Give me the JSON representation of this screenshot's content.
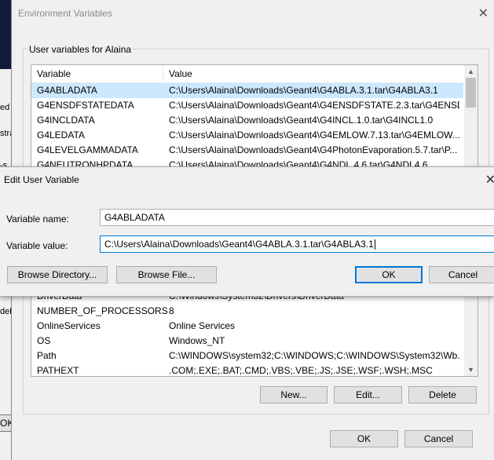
{
  "background_fragments": [
    "ed",
    "stra",
    "-s",
    "deb",
    "OK"
  ],
  "env_window": {
    "title": "Environment Variables",
    "user_group_label": "User variables for Alaina",
    "columns": [
      "Variable",
      "Value"
    ],
    "rows_top": [
      {
        "variable": "G4ABLADATA",
        "value": "C:\\Users\\Alaina\\Downloads\\Geant4\\G4ABLA.3.1.tar\\G4ABLA3.1"
      },
      {
        "variable": "G4ENSDFSTATEDATA",
        "value": "C:\\Users\\Alaina\\Downloads\\Geant4\\G4ENSDFSTATE.2.3.tar\\G4ENSD..."
      },
      {
        "variable": "G4INCLDATA",
        "value": "C:\\Users\\Alaina\\Downloads\\Geant4\\G4INCL.1.0.tar\\G4INCL1.0"
      },
      {
        "variable": "G4LEDATA",
        "value": "C:\\Users\\Alaina\\Downloads\\Geant4\\G4EMLOW.7.13.tar\\G4EMLOW..."
      },
      {
        "variable": "G4LEVELGAMMADATA",
        "value": "C:\\Users\\Alaina\\Downloads\\Geant4\\G4PhotonEvaporation.5.7.tar\\P..."
      },
      {
        "variable": "G4NEUTRONHPDATA",
        "value": "C:\\Users\\Alaina\\Downloads\\Geant4\\G4NDL.4.6.tar\\G4NDL4.6"
      }
    ],
    "rows_bottom": [
      {
        "variable": "DriverData",
        "value": "C:\\Windows\\System32\\Drivers\\DriverData"
      },
      {
        "variable": "NUMBER_OF_PROCESSORS",
        "value": "8"
      },
      {
        "variable": "OnlineServices",
        "value": "Online Services"
      },
      {
        "variable": "OS",
        "value": "Windows_NT"
      },
      {
        "variable": "Path",
        "value": "C:\\WINDOWS\\system32;C:\\WINDOWS;C:\\WINDOWS\\System32\\Wb..."
      },
      {
        "variable": "PATHEXT",
        "value": ".COM;.EXE;.BAT;.CMD;.VBS;.VBE;.JS;.JSE;.WSF;.WSH;.MSC"
      }
    ],
    "buttons": {
      "new": "New...",
      "edit": "Edit...",
      "delete": "Delete",
      "ok": "OK",
      "cancel": "Cancel"
    }
  },
  "edit_dialog": {
    "title": "Edit User Variable",
    "name_label": "Variable name:",
    "name_value": "G4ABLADATA",
    "value_label": "Variable value:",
    "value_value": "C:\\Users\\Alaina\\Downloads\\Geant4\\G4ABLA.3.1.tar\\G4ABLA3.1",
    "buttons": {
      "browse_directory": "Browse Directory...",
      "browse_file": "Browse File...",
      "ok": "OK",
      "cancel": "Cancel"
    }
  },
  "colors": {
    "selection": "#cce8ff",
    "focus_border": "#0078d7",
    "button_face": "#e1e1e1"
  }
}
